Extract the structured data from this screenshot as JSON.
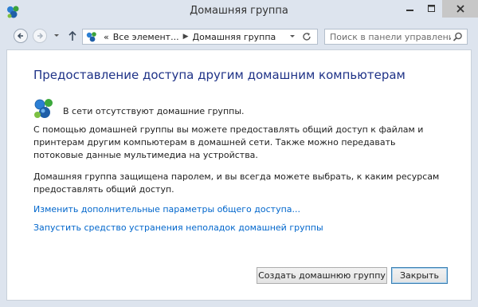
{
  "window": {
    "title": "Домашняя группа"
  },
  "address_bar": {
    "overflow": "«",
    "crumb1": "Все элемент...",
    "crumb2": "Домашняя группа"
  },
  "search": {
    "placeholder": "Поиск в панели управления"
  },
  "content": {
    "heading": "Предоставление доступа другим домашним компьютерам",
    "status": "В сети отсутствуют домашние группы.",
    "description": "С помощью домашней группы вы можете предоставлять общий доступ к файлам и принтерам другим компьютерам в домашней сети. Также можно передавать потоковые данные мультимедиа на устройства.",
    "password_note": "Домашняя группа защищена паролем, и вы всегда можете выбрать, к каким ресурсам предоставлять общий доступ.",
    "link_advanced": "Изменить дополнительные параметры общего доступа...",
    "link_troubleshoot": "Запустить средство устранения неполадок домашней группы"
  },
  "buttons": {
    "create": "Создать домашнюю группу",
    "close": "Закрыть"
  },
  "icons": {
    "app": "homegroup-icon",
    "network": "homegroup-network-icon"
  },
  "colors": {
    "heading": "#1e3287",
    "link": "#0066cc",
    "chrome": "#dde4ee"
  }
}
